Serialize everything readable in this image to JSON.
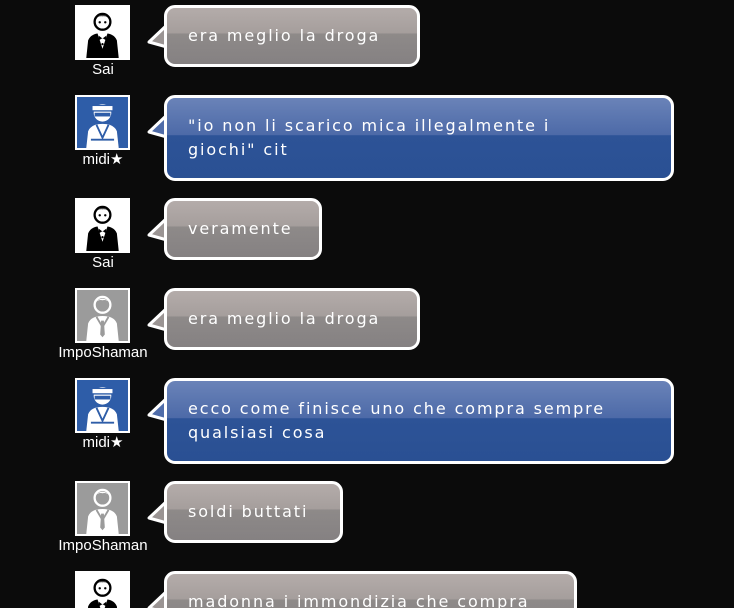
{
  "messages": [
    {
      "user": "Sai",
      "avatar": "butler-avatar-icon",
      "text": "era meglio la droga",
      "style": "gray"
    },
    {
      "user": "midi★",
      "avatar": "ninja-avatar-icon",
      "text": "\"io non li scarico mica illegalmente i\ngiochi\" cit",
      "style": "blue"
    },
    {
      "user": "Sai",
      "avatar": "butler-avatar-icon",
      "text": "veramente",
      "style": "gray"
    },
    {
      "user": "ImpoShaman",
      "avatar": "default-avatar-icon",
      "text": "era meglio la droga",
      "style": "gray"
    },
    {
      "user": "midi★",
      "avatar": "ninja-avatar-icon",
      "text": "ecco come finisce uno che compra sempre\nqualsiasi cosa",
      "style": "blue"
    },
    {
      "user": "ImpoShaman",
      "avatar": "default-avatar-icon",
      "text": "soldi buttati",
      "style": "gray"
    },
    {
      "user": "",
      "avatar": "butler-avatar-icon",
      "text": "madonna i immondizia che compra",
      "style": "gray"
    }
  ],
  "colors": {
    "background": "#0b0b0b",
    "bubble_gray": "#a59e9c",
    "bubble_blue": "#2d5397",
    "border": "#ffffff"
  }
}
